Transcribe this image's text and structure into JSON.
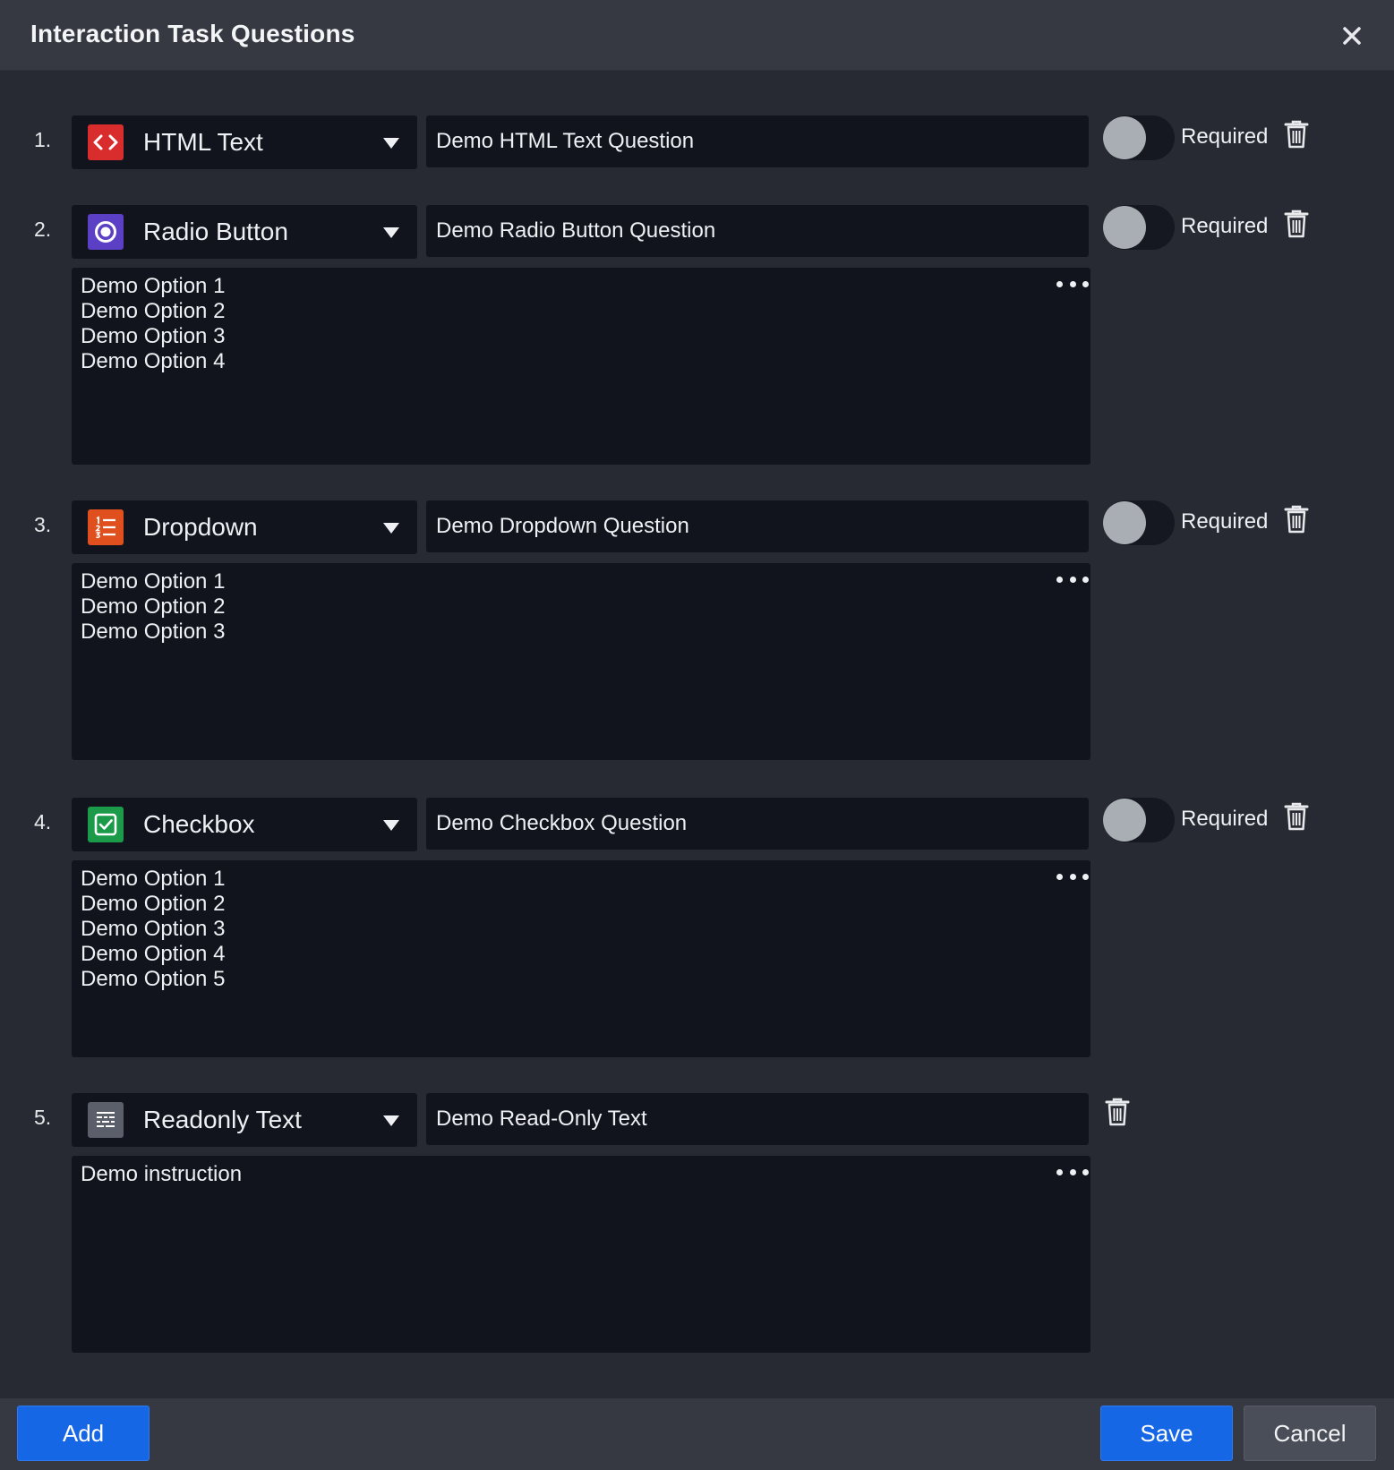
{
  "dialog": {
    "title": "Interaction Task Questions",
    "close_icon": "close-icon"
  },
  "colors": {
    "html_text": "#d92d2d",
    "radio_button": "#5b3fc4",
    "dropdown": "#e0501f",
    "checkbox": "#1b9a4a",
    "readonly_text": "#5a5f69",
    "primary_button": "#1667e6"
  },
  "questions": [
    {
      "number": "1.",
      "type_label": "HTML Text",
      "type_icon": "code-brackets-icon",
      "question_text": "Demo HTML Text Question",
      "required_label": "Required",
      "required": false
    },
    {
      "number": "2.",
      "type_label": "Radio Button",
      "type_icon": "radio-button-icon",
      "question_text": "Demo Radio Button Question",
      "required_label": "Required",
      "required": false,
      "options_text": "Demo Option 1\nDemo Option 2\nDemo Option 3\nDemo Option 4"
    },
    {
      "number": "3.",
      "type_label": "Dropdown",
      "type_icon": "numbered-list-icon",
      "question_text": "Demo Dropdown Question",
      "required_label": "Required",
      "required": false,
      "options_text": "Demo Option 1\nDemo Option 2\nDemo Option 3"
    },
    {
      "number": "4.",
      "type_label": "Checkbox",
      "type_icon": "checkbox-icon",
      "question_text": "Demo Checkbox Question",
      "required_label": "Required",
      "required": false,
      "options_text": "Demo Option 1\nDemo Option 2\nDemo Option 3\nDemo Option 4\nDemo Option 5"
    },
    {
      "number": "5.",
      "type_label": "Readonly Text",
      "type_icon": "text-block-icon",
      "question_text": "Demo Read-Only Text",
      "options_text": "Demo instruction"
    }
  ],
  "footer": {
    "add_label": "Add",
    "save_label": "Save",
    "cancel_label": "Cancel"
  }
}
